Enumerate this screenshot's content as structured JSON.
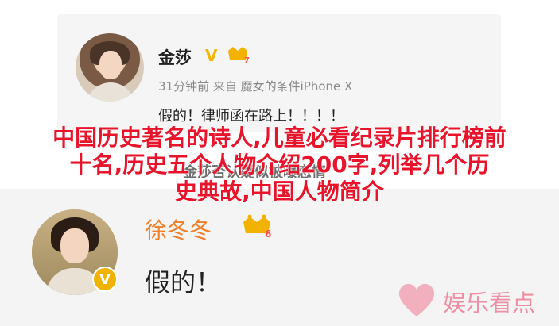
{
  "top_post": {
    "author": "金莎",
    "verified_mark": "V",
    "vip_level": "7",
    "meta": "31分钟前 来自 魔女的条件iPhone X",
    "text": "假的！律师函在路上！！！！"
  },
  "overlay": {
    "middle_watermark": "金莎否认疑似被曝恋情",
    "headline_line1": "中国历史著名的诗人,儿童必看纪录片排行榜前",
    "headline_line2": "十名,历史五个人物介绍200字,列举几个历",
    "headline_line3": "史典故,中国人物简介"
  },
  "bottom_post": {
    "author": "徐冬冬",
    "vip_level": "6",
    "verify_mark": "V",
    "text": "假的！"
  },
  "branding": {
    "logo_text": "娱乐看点"
  },
  "colors": {
    "headline": "#e8142c",
    "bottom_name": "#f07f2a",
    "logo": "#ef8fa6",
    "vip": "#f2b300"
  }
}
